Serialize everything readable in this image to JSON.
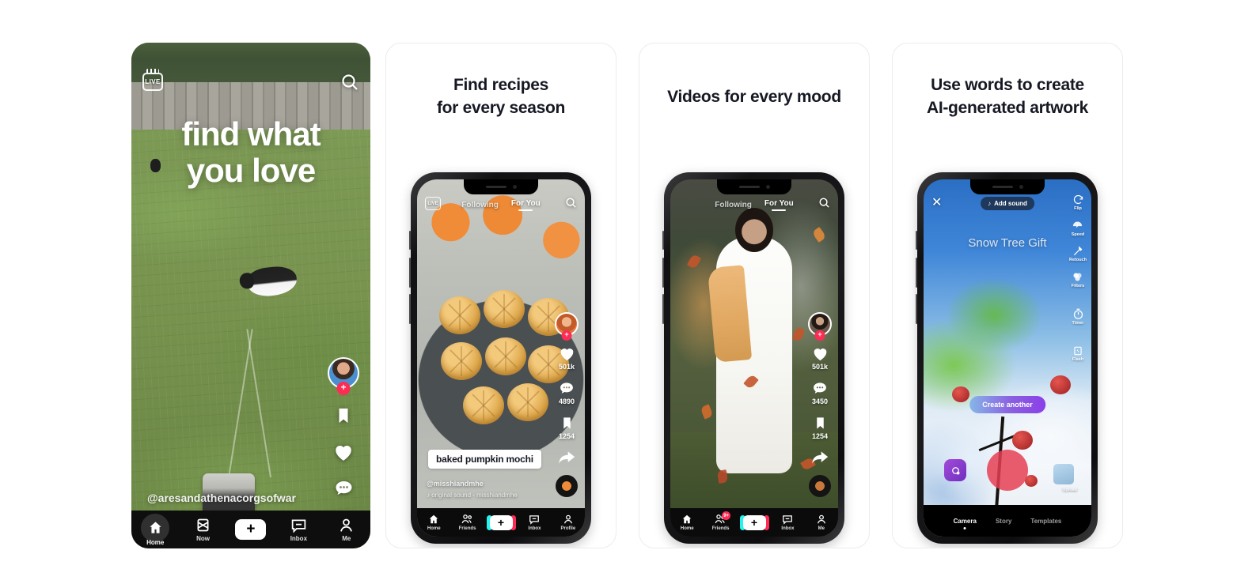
{
  "page": {
    "background_color": "#ffffff",
    "card_border_color": "#ececec",
    "accent_red": "#fe2c55",
    "accent_cyan": "#25f4ee",
    "text_color": "#161823"
  },
  "cards": [
    {
      "id": "card-1-find-what-you-love",
      "title": null,
      "screen": {
        "live_badge": "LIVE",
        "search_icon": "search-icon",
        "hero_line_1": "find what",
        "hero_line_2": "you love",
        "handle": "@aresandathenacorgsofwar",
        "rail": [
          {
            "icon": "avatar",
            "label": ""
          },
          {
            "icon": "follow-plus",
            "label": ""
          },
          {
            "icon": "bookmark-icon",
            "label": ""
          },
          {
            "icon": "heart-icon",
            "label": ""
          },
          {
            "icon": "comment-icon",
            "label": ""
          },
          {
            "icon": "share-icon",
            "label": ""
          }
        ],
        "nav": [
          {
            "label": "Home",
            "icon": "home-icon",
            "active": true
          },
          {
            "label": "Now",
            "icon": "now-icon",
            "active": false
          },
          {
            "label": "",
            "icon": "create-plus-icon",
            "active": false
          },
          {
            "label": "Inbox",
            "icon": "inbox-icon",
            "active": false
          },
          {
            "label": "Me",
            "icon": "profile-icon",
            "active": false
          }
        ]
      }
    },
    {
      "id": "card-2-recipes",
      "title_line_1": "Find recipes",
      "title_line_2": "for every season",
      "screen": {
        "live_badge": "LIVE",
        "tabs": [
          {
            "label": "Following",
            "selected": false
          },
          {
            "label": "For You",
            "selected": true
          }
        ],
        "search_icon": "search-icon",
        "caption": "baked pumpkin mochi",
        "username": "@misshiandmhe",
        "song": "original sound - misshiandmhe",
        "rail": [
          {
            "icon": "avatar",
            "label": ""
          },
          {
            "icon": "heart-icon",
            "label": "501k"
          },
          {
            "icon": "comment-icon",
            "label": "4890"
          },
          {
            "icon": "bookmark-icon",
            "label": "1254"
          },
          {
            "icon": "share-icon",
            "label": ""
          },
          {
            "icon": "music-disc-icon",
            "label": ""
          }
        ],
        "nav": [
          {
            "label": "Home",
            "icon": "home-icon",
            "active": true
          },
          {
            "label": "Friends",
            "icon": "friends-icon",
            "active": false
          },
          {
            "label": "",
            "icon": "create-plus-icon",
            "active": false
          },
          {
            "label": "Inbox",
            "icon": "inbox-icon",
            "active": false
          },
          {
            "label": "Profile",
            "icon": "profile-icon",
            "active": false
          }
        ]
      }
    },
    {
      "id": "card-3-moods",
      "title_line_1": "Videos for every mood",
      "title_line_2": "",
      "screen": {
        "tabs": [
          {
            "label": "Following",
            "selected": false
          },
          {
            "label": "For You",
            "selected": true
          }
        ],
        "search_icon": "search-icon",
        "rail": [
          {
            "icon": "avatar",
            "label": ""
          },
          {
            "icon": "heart-icon",
            "label": "501k"
          },
          {
            "icon": "comment-icon",
            "label": "3450"
          },
          {
            "icon": "bookmark-icon",
            "label": "1254"
          },
          {
            "icon": "share-icon",
            "label": ""
          },
          {
            "icon": "music-disc-icon",
            "label": ""
          }
        ],
        "nav": [
          {
            "label": "Home",
            "icon": "home-icon",
            "active": true
          },
          {
            "label": "Friends",
            "icon": "friends-icon",
            "active": false,
            "badge": "9+"
          },
          {
            "label": "",
            "icon": "create-plus-icon",
            "active": false
          },
          {
            "label": "Inbox",
            "icon": "inbox-icon",
            "active": false
          },
          {
            "label": "Me",
            "icon": "profile-icon",
            "active": false
          }
        ]
      }
    },
    {
      "id": "card-4-ai-artwork",
      "title_line_1": "Use words to create",
      "title_line_2": "AI-generated artwork",
      "screen": {
        "close_icon": "close-icon",
        "add_sound": "Add sound",
        "prompt_title": "Snow Tree Gift",
        "tools": [
          {
            "label": "Flip",
            "icon": "flip-camera-icon"
          },
          {
            "label": "Speed",
            "icon": "speed-icon"
          },
          {
            "label": "Retouch",
            "icon": "retouch-wand-icon"
          },
          {
            "label": "Filters",
            "icon": "filters-icon"
          },
          {
            "label": "Timer",
            "icon": "timer-icon"
          },
          {
            "label": "Flash",
            "icon": "flash-icon"
          }
        ],
        "create_another": "Create another",
        "upload_label": "Upload",
        "effects_icon": "effects-icon",
        "shutter_icon": "shutter-button",
        "cam_tabs": [
          {
            "label": "Camera",
            "active": true
          },
          {
            "label": "Story",
            "active": false
          },
          {
            "label": "Templates",
            "active": false
          }
        ]
      }
    }
  ]
}
